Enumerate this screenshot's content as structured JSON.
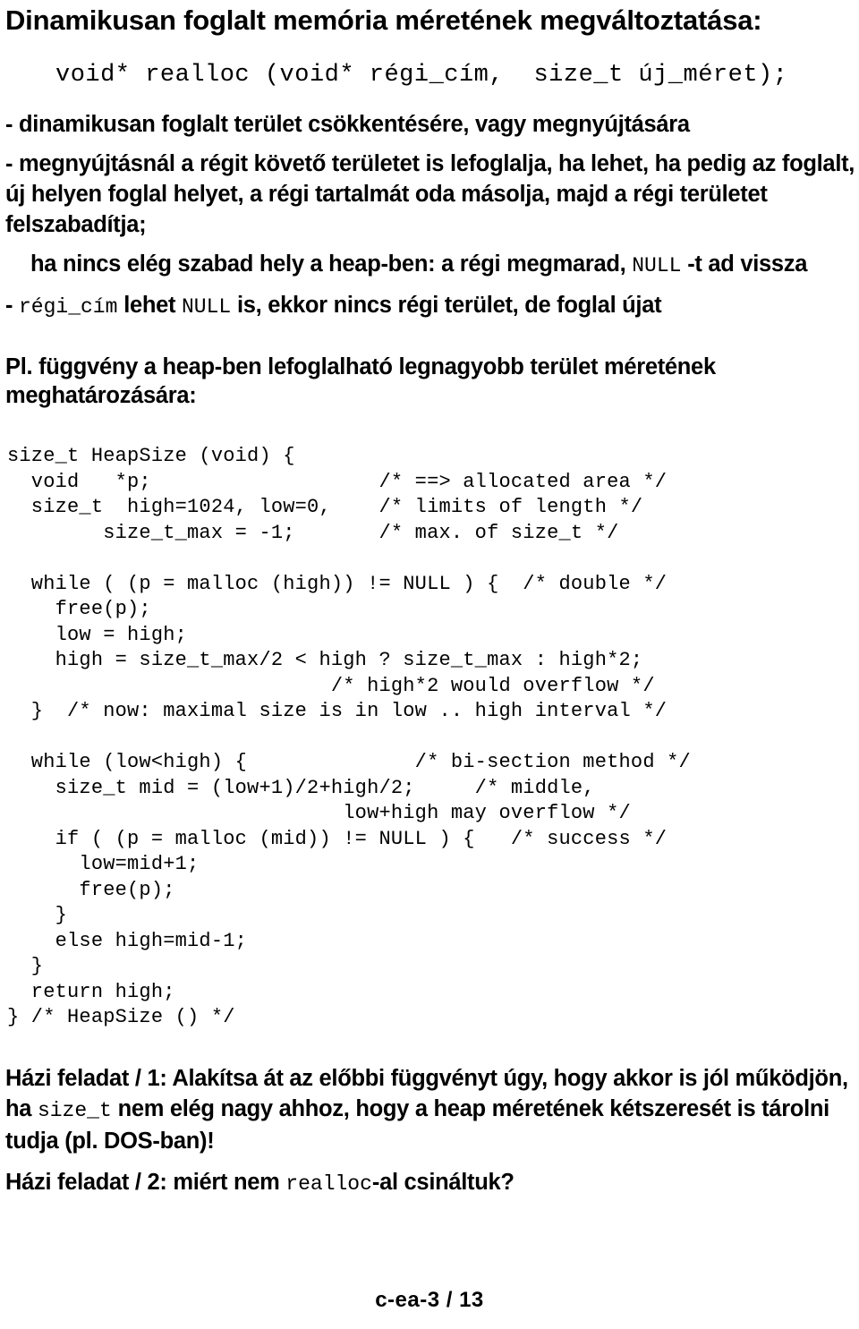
{
  "slide": {
    "title": "Dinamikusan foglalt memória méretének megváltoztatása:",
    "signature": "void* realloc (void* régi_cím,  size_t új_méret);",
    "bullets": {
      "b1": "- dinamikusan foglalt terület csökkentésére, vagy megnyújtására",
      "b2": "- megnyújtásnál a régit követő területet is lefoglalja, ha lehet, ha pedig az foglalt, új helyen foglal helyet, a régi tartalmát oda másolja, majd a régi területet felszabadítja;",
      "b3_part1": "ha nincs elég szabad hely a heap-ben: a régi megmarad, ",
      "b3_mono": "NULL",
      "b3_part2": " -t ad vissza",
      "b4_dash": "- ",
      "b4_mono1": "régi_cím",
      "b4_text1": " lehet ",
      "b4_mono2": "NULL",
      "b4_text2": " is, ekkor nincs régi terület, de foglal újat"
    },
    "section_heading": "Pl. függvény a heap-ben lefoglalható legnagyobb terület  méretének\nmeghatározására:",
    "code": "size_t HeapSize (void) {\n  void   *p;                   /* ==> allocated area */\n  size_t  high=1024, low=0,    /* limits of length */\n        size_t_max = -1;       /* max. of size_t */\n\n  while ( (p = malloc (high)) != NULL ) {  /* double */\n    free(p);\n    low = high;\n    high = size_t_max/2 < high ? size_t_max : high*2;\n                           /* high*2 would overflow */\n  }  /* now: maximal size is in low .. high interval */\n\n  while (low<high) {              /* bi-section method */\n    size_t mid = (low+1)/2+high/2;     /* middle,\n                            low+high may overflow */\n    if ( (p = malloc (mid)) != NULL ) {   /* success */\n      low=mid+1;\n      free(p);\n    }\n    else high=mid-1;\n  }\n  return high;\n} /* HeapSize () */",
    "homework": {
      "hw1_part1": "Házi feladat  / 1:  Alakítsa át az előbbi függvényt úgy, hogy akkor is jól működjön, ha ",
      "hw1_mono": "size_t",
      "hw1_part2": " nem elég nagy ahhoz, hogy a heap méretének kétszeresét is tárolni tudja (pl. DOS-ban)!",
      "hw2_part1": "Házi feladat  / 2: miért nem ",
      "hw2_mono": "realloc",
      "hw2_part2": "-al csináltuk?"
    },
    "footer": "c-ea-3  /  13"
  }
}
